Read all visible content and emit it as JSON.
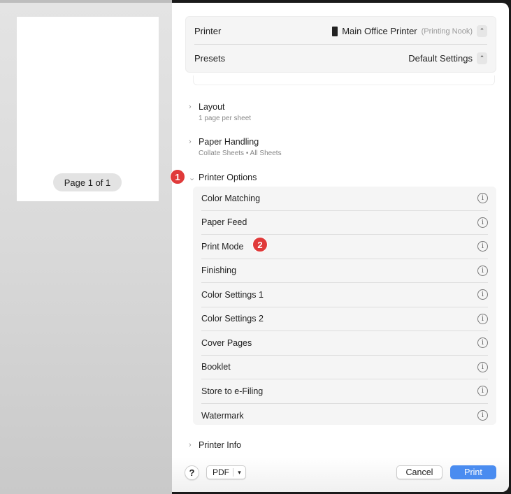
{
  "preview": {
    "page_label": "Page 1 of 1"
  },
  "printer": {
    "label": "Printer",
    "value": "Main Office Printer",
    "location": "(Printing Nook)"
  },
  "presets": {
    "label": "Presets",
    "value": "Default Settings"
  },
  "sections": {
    "layout": {
      "title": "Layout",
      "subtitle": "1 page per sheet"
    },
    "paper": {
      "title": "Paper Handling",
      "subtitle": "Collate Sheets • All Sheets"
    },
    "options": {
      "title": "Printer Options",
      "items": [
        "Color Matching",
        "Paper Feed",
        "Print Mode",
        "Finishing",
        "Color Settings 1",
        "Color Settings 2",
        "Cover Pages",
        "Booklet",
        "Store to e-Filing",
        "Watermark"
      ]
    },
    "info": {
      "title": "Printer Info"
    }
  },
  "annotations": {
    "one": "1",
    "two": "2"
  },
  "footer": {
    "help": "?",
    "pdf": "PDF",
    "cancel": "Cancel",
    "print": "Print"
  },
  "colors": {
    "accent": "#4a8cf0",
    "badge": "#e03a3a"
  }
}
